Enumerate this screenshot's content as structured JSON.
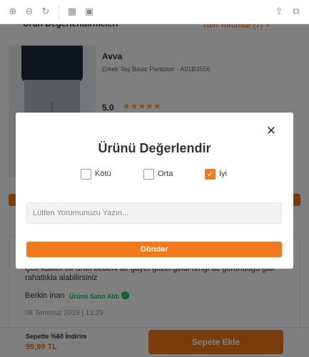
{
  "toolbar": {
    "left_icons": [
      "zoom-in-icon",
      "zoom-out-icon",
      "refresh-icon",
      "grid-view-icon",
      "page-view-icon"
    ],
    "right_icons": [
      "share-icon",
      "copy-icon"
    ],
    "glyphs": {
      "zoom_in": "⊕",
      "zoom_out": "⊖",
      "refresh": "↻",
      "grid": "▦",
      "page": "▣",
      "share": "⇪",
      "copy": "⧉"
    }
  },
  "section": {
    "title": "Ürün Değerlendirmeleri",
    "all_reviews_label": "Tüm Yorumlar (7)",
    "chevron": "›"
  },
  "product": {
    "brand": "Avva",
    "name": "Erkek Taş Basic Pantolon - A91B3556",
    "rating": "5.0",
    "stars": "★★★★★",
    "star_color": "#f5a623"
  },
  "review": {
    "text": "Çok kaliteli bir ürün bedeni de gayet güzel geldi rengi de göründüğü gibi rahatlıkla alabilirsiniz",
    "author": "Berkin İnan",
    "verified_label": "Ürünü Satın Aldı",
    "verified_icon": "✓",
    "date": "08 Temmuz 2019 | 13:29"
  },
  "bottom_bar": {
    "discount_label": "Sepette %60 İndirim",
    "price": "99,99 TL",
    "add_to_cart_label": "Sepete Ekle"
  },
  "modal": {
    "title": "Ürünü Değerlendir",
    "close_glyph": "✕",
    "options": [
      {
        "label": "Kötü",
        "checked": false
      },
      {
        "label": "Orta",
        "checked": false
      },
      {
        "label": "İyi",
        "checked": true
      }
    ],
    "check_glyph": "✓",
    "input_placeholder": "Lütfen Yorumunuzu Yazın...",
    "input_value": "",
    "submit_label": "Gönder"
  },
  "colors": {
    "accent": "#f27a1a",
    "verified_green": "#0bc15c"
  }
}
